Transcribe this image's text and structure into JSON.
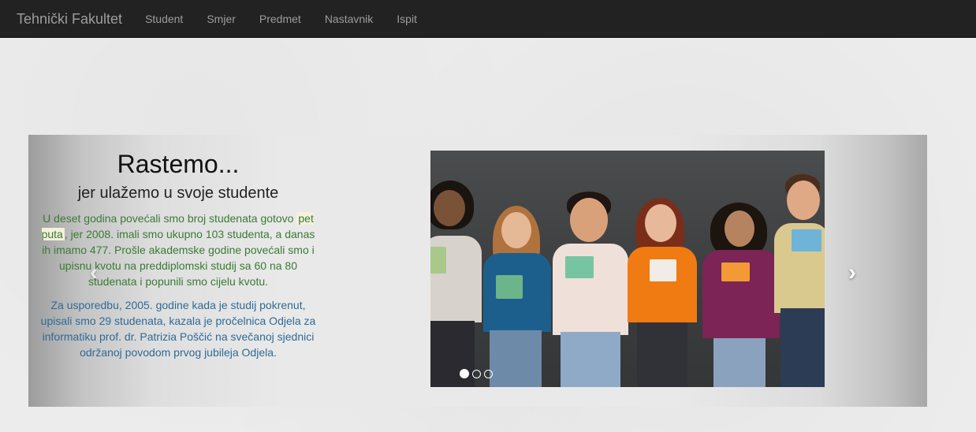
{
  "navbar": {
    "brand": "Tehnički Fakultet",
    "items": [
      {
        "label": "Student"
      },
      {
        "label": "Smjer"
      },
      {
        "label": "Predmet"
      },
      {
        "label": "Nastavnik"
      },
      {
        "label": "Ispit"
      }
    ]
  },
  "slide": {
    "title": "Rastemo...",
    "subtitle": "jer ulažemo u svoje studente",
    "para1_a": "U deset godina povećali smo broj studenata gotovo ",
    "para1_hl": "pet puta",
    "para1_b": ", jer 2008. imali smo ukupno 103 studenta, a danas ih imamo 477. Prošle akademske godine povećali smo i upisnu kvotu na preddiplomski studij sa 60 na 80 studenata i popunili smo cijelu kvotu.",
    "para2": "Za usporedbu, 2005. godine kada je studij pokrenut, upisali smo 29 studenata, kazala je pročelnica Odjela za informatiku prof. dr. Patrizia Poščić na svečanoj sjednici održanoj povodom prvog jubileja Odjela."
  },
  "carousel": {
    "prev_icon": "‹",
    "next_icon": "›",
    "indicator_count": 3,
    "active_index": 0
  },
  "colors": {
    "navbar_bg": "#222222",
    "nav_text": "#9d9d9d",
    "para1": "#3b7a35",
    "para2": "#2f6a96"
  }
}
